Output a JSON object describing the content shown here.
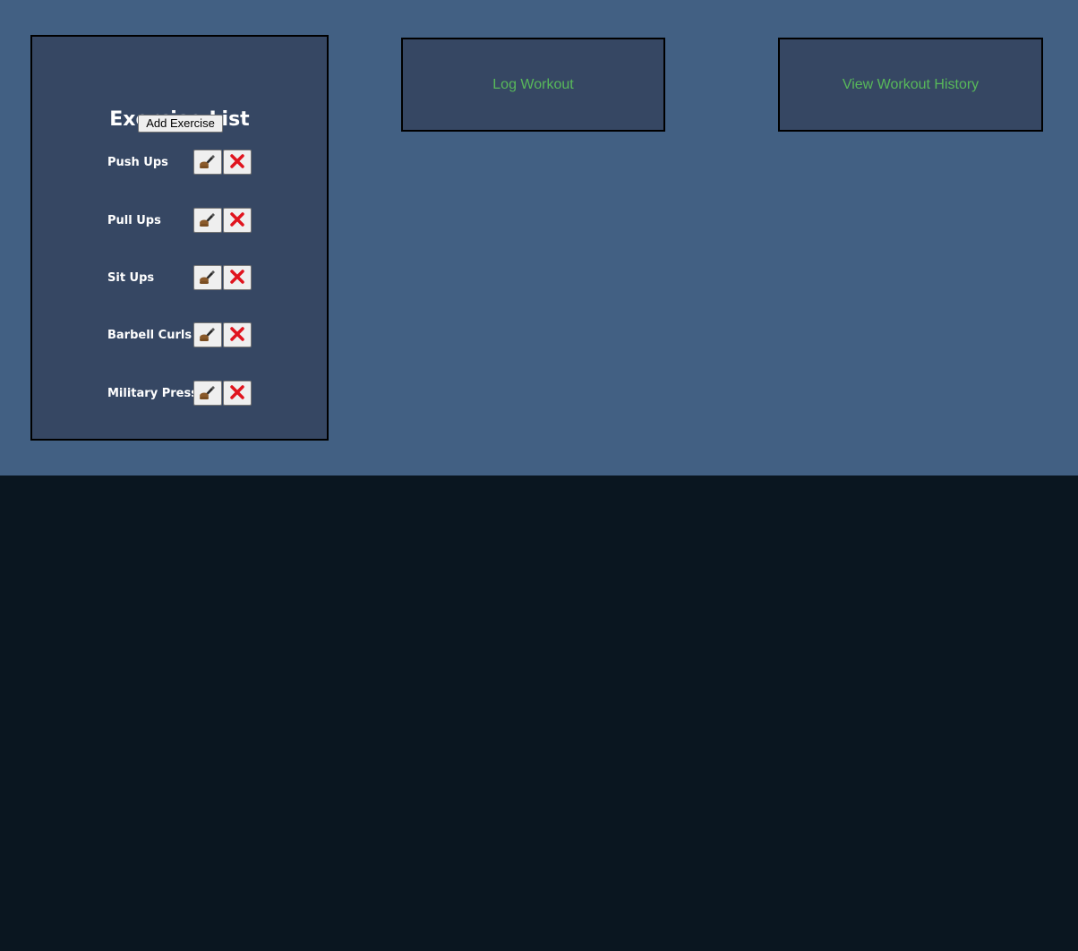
{
  "exercise_panel": {
    "title": "Exercise List",
    "add_button_label": "Add Exercise",
    "exercises": [
      {
        "name": "Push Ups"
      },
      {
        "name": "Pull Ups"
      },
      {
        "name": "Sit Ups"
      },
      {
        "name": "Barbell Curls"
      },
      {
        "name": "Military Press"
      }
    ],
    "edit_icon": "writing-hand-icon",
    "delete_icon": "cross-mark-icon"
  },
  "nav": {
    "log_workout_label": "Log Workout",
    "view_history_label": "View Workout History"
  },
  "colors": {
    "top_background": "#426083",
    "page_background": "#0a1620",
    "panel_background": "#364763",
    "link_green": "#58b95a",
    "delete_red": "#e0141e"
  }
}
